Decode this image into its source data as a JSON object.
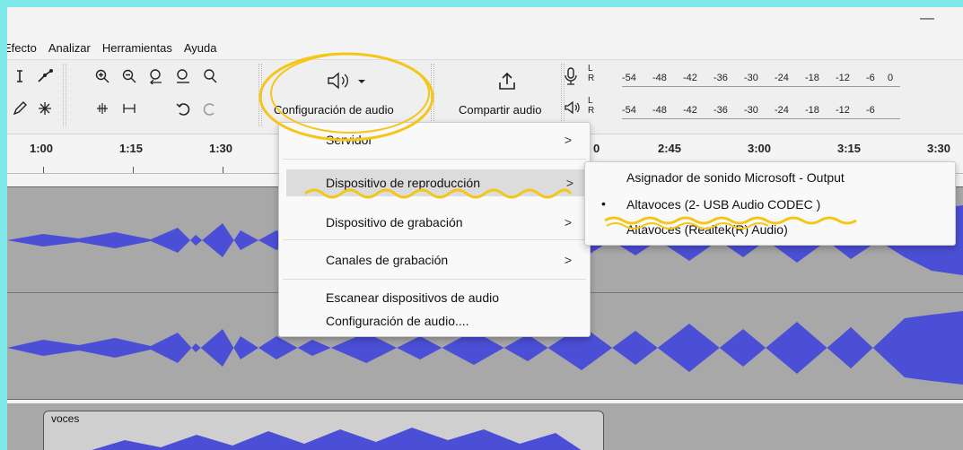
{
  "window": {
    "minimize_glyph": "—"
  },
  "menubar": {
    "items": [
      {
        "label": "Efecto"
      },
      {
        "label": "Analizar"
      },
      {
        "label": "Herramientas"
      },
      {
        "label": "Ayuda"
      }
    ]
  },
  "toolbar": {
    "audio_setup_label": "Configuración de audio",
    "audio_setup_icon": "speaker-dropdown-icon",
    "share_label": "Compartir audio",
    "share_icon": "share-upload-icon",
    "meter": {
      "record_lr": "L\nR",
      "play_lr": "L\nR",
      "ticks": [
        "-54",
        "-48",
        "-42",
        "-36",
        "-30",
        "-24",
        "-18",
        "-12",
        "-6",
        "0"
      ]
    }
  },
  "timeline": {
    "ticks": [
      "1:00",
      "1:15",
      "1:30",
      "",
      "2:45",
      "3:00",
      "3:15",
      "3:30"
    ],
    "partial_tick": "0"
  },
  "clip": {
    "name": "voces"
  },
  "audio_menu": {
    "items": [
      {
        "label": "Servidor",
        "submenu": true
      },
      {
        "label": "Dispositivo de reproducción",
        "submenu": true,
        "highlighted": true
      },
      {
        "label": "Dispositivo de grabación",
        "submenu": true
      },
      {
        "label": "Canales de grabación",
        "submenu": true
      },
      {
        "label": "Escanear dispositivos de audio",
        "submenu": false
      },
      {
        "label": "Configuración de audio....",
        "submenu": false
      }
    ],
    "arrow_glyph": ">"
  },
  "playback_submenu": {
    "items": [
      {
        "label": "Asignador de sonido Microsoft - Output",
        "selected": false
      },
      {
        "label": "Altavoces (2- USB Audio CODEC )",
        "selected": true
      },
      {
        "label": "Altavoces (Realtek(R) Audio)",
        "selected": false
      }
    ],
    "bullet": "•"
  },
  "colors": {
    "frame": "#7fe9ea",
    "waveform": "#4b4fd6",
    "track_bg": "#a8a8a8",
    "highlight_marker": "#f5c518"
  }
}
